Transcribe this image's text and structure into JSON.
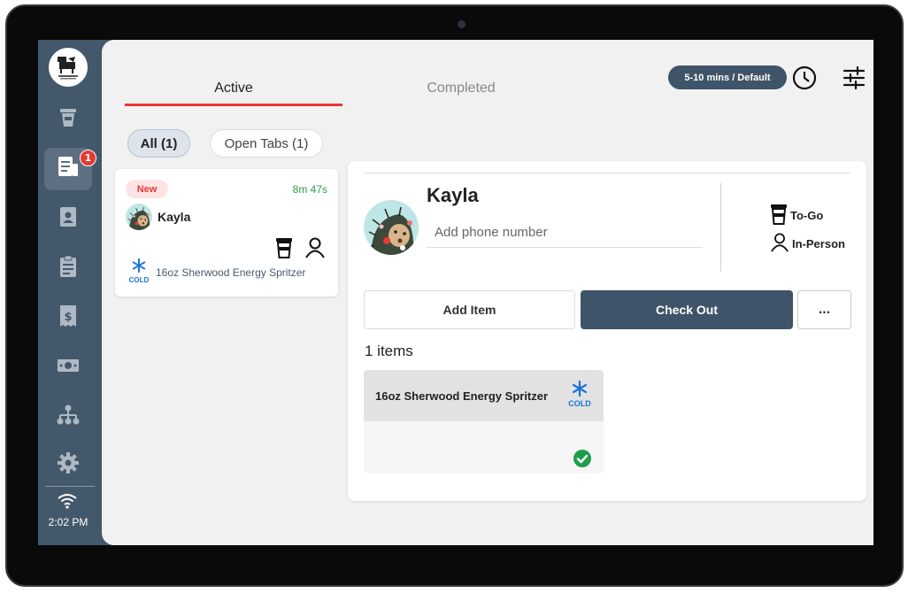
{
  "sidebar": {
    "badge_count": "1",
    "time": "2:02 PM"
  },
  "tabs": {
    "active": "Active",
    "completed": "Completed"
  },
  "header": {
    "eta": "5-10 mins / Default"
  },
  "filters": {
    "all": "All (1)",
    "open_tabs": "Open Tabs (1)"
  },
  "order_card": {
    "status": "New",
    "elapsed": "8m 47s",
    "name": "Kayla",
    "cold_label": "COLD",
    "item": "16oz Sherwood Energy Spritzer"
  },
  "detail": {
    "name": "Kayla",
    "phone_placeholder": "Add phone number",
    "mode_to_go": "To-Go",
    "mode_in_person": "In-Person",
    "add_item": "Add Item",
    "check_out": "Check Out",
    "more": "...",
    "items_count": "1 items",
    "item_name": "16oz Sherwood Energy Spritzer",
    "item_cold_label": "COLD"
  },
  "colors": {
    "sidebar": "#44586b",
    "accent_red": "#e53935",
    "primary_button": "#3f5468",
    "success_green": "#1e9e4a",
    "cold_blue": "#1a73d9"
  }
}
